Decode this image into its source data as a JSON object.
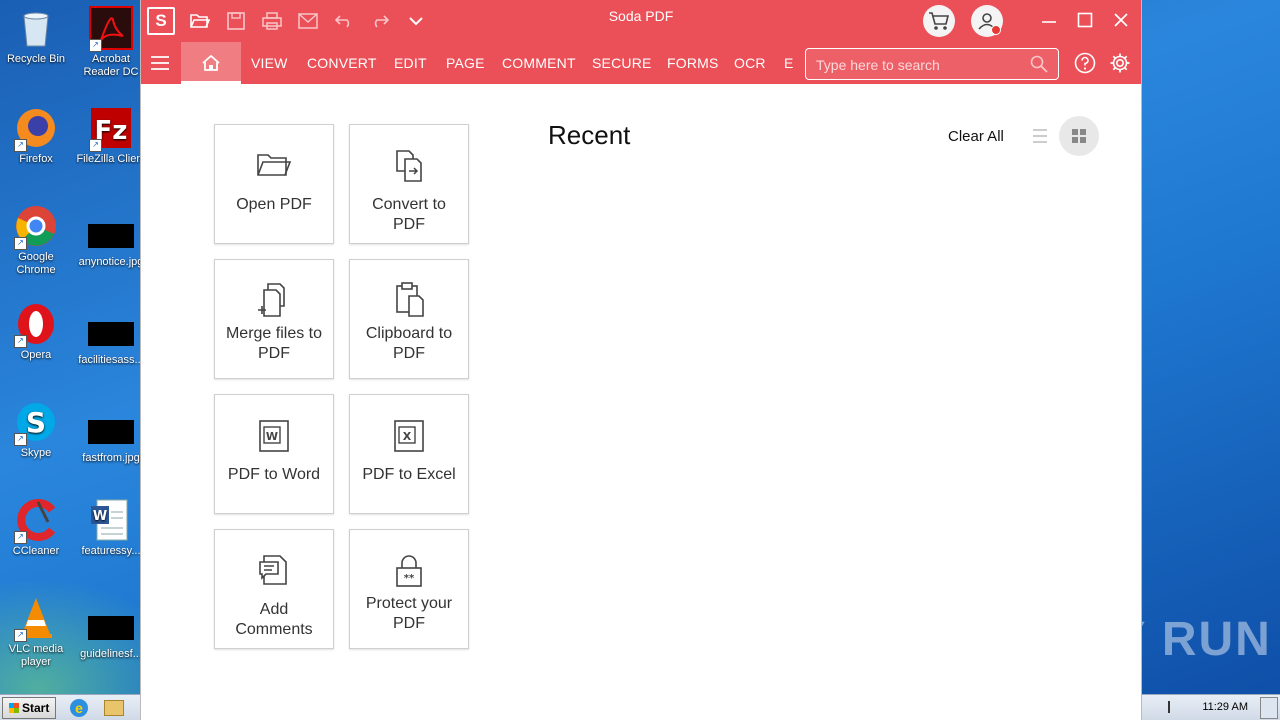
{
  "desktop": {
    "icons": [
      {
        "label": "Recycle Bin",
        "icon": "recycle-bin-icon"
      },
      {
        "label": "Acrobat Reader DC",
        "icon": "acrobat-icon"
      },
      {
        "label": "Firefox",
        "icon": "firefox-icon"
      },
      {
        "label": "FileZilla Client",
        "icon": "filezilla-icon"
      },
      {
        "label": "Google Chrome",
        "icon": "chrome-icon"
      },
      {
        "label": "anynotice.jpg",
        "icon": "image-file-icon"
      },
      {
        "label": "Opera",
        "icon": "opera-icon"
      },
      {
        "label": "facilitiesass...",
        "icon": "image-file-icon"
      },
      {
        "label": "Skype",
        "icon": "skype-icon"
      },
      {
        "label": "fastfrom.jpg",
        "icon": "image-file-icon"
      },
      {
        "label": "CCleaner",
        "icon": "ccleaner-icon"
      },
      {
        "label": "featuressy...",
        "icon": "word-doc-icon"
      },
      {
        "label": "VLC media player",
        "icon": "vlc-icon"
      },
      {
        "label": "guidelinesf...",
        "icon": "image-file-icon"
      }
    ]
  },
  "taskbar": {
    "start_label": "Start",
    "clock": "11:29 AM"
  },
  "app": {
    "title": "Soda PDF",
    "logo_letter": "S",
    "accent_color": "#eb4f57",
    "tabs": [
      "VIEW",
      "CONVERT",
      "EDIT",
      "PAGE",
      "COMMENT",
      "SECURE",
      "FORMS",
      "OCR",
      "E"
    ],
    "search_placeholder": "Type here to search"
  },
  "home": {
    "tiles": [
      {
        "label": "Open PDF",
        "icon": "folder-open-icon"
      },
      {
        "label": "Convert to PDF",
        "icon": "convert-icon"
      },
      {
        "label": "Merge files to PDF",
        "icon": "merge-icon"
      },
      {
        "label": "Clipboard to PDF",
        "icon": "clipboard-icon"
      },
      {
        "label": "PDF to Word",
        "icon": "word-icon"
      },
      {
        "label": "PDF to Excel",
        "icon": "excel-icon"
      },
      {
        "label": "Add Comments",
        "icon": "comment-icon"
      },
      {
        "label": "Protect your PDF",
        "icon": "lock-icon"
      }
    ],
    "recent_title": "Recent",
    "clear_all": "Clear All"
  },
  "watermark": "ANY RUN"
}
